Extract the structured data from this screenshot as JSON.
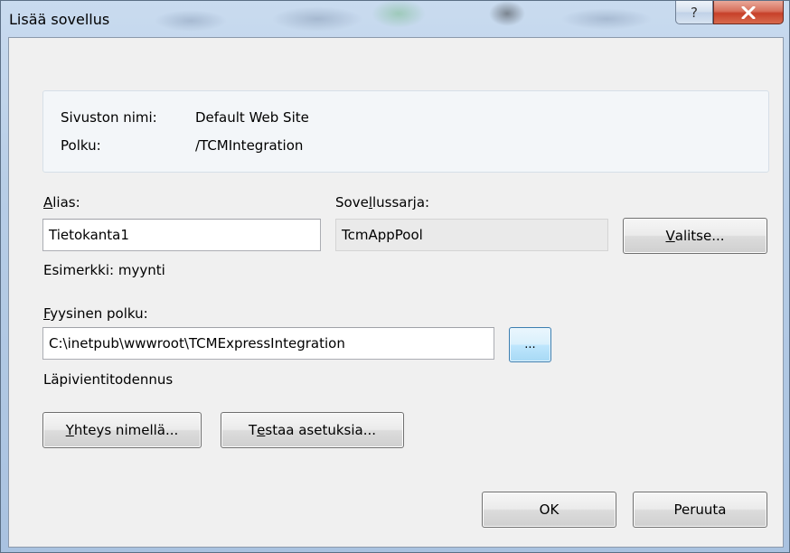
{
  "window": {
    "title": "Lisää sovellus",
    "help_label": "?",
    "close_icon": "close-icon",
    "close_color": "#c7402a"
  },
  "site": {
    "name_label": "Sivuston nimi:",
    "name_value": "Default Web Site",
    "path_label": "Polku:",
    "path_value": "/TCMIntegration"
  },
  "alias": {
    "label_mnemonic": "A",
    "label_rest": "lias:",
    "value": "Tietokanta1",
    "example": "Esimerkki: myynti"
  },
  "app_pool": {
    "label_pre": "Sove",
    "label_mnemonic": "l",
    "label_rest": "lussarja:",
    "value": "TcmAppPool",
    "select_mnemonic": "V",
    "select_rest": "alitse..."
  },
  "physical_path": {
    "label_mnemonic": "F",
    "label_rest": "yysinen polku:",
    "value": "C:\\inetpub\\wwwroot\\TCMExpressIntegration",
    "browse_label": "..."
  },
  "auth": {
    "heading": "Läpivientitodennus",
    "connect_as_mnemonic": "Y",
    "connect_as_rest": "hteys nimellä...",
    "test_pre": "T",
    "test_mnemonic": "e",
    "test_rest": "staa asetuksia..."
  },
  "footer": {
    "ok_label": "OK",
    "cancel_label": "Peruuta"
  }
}
